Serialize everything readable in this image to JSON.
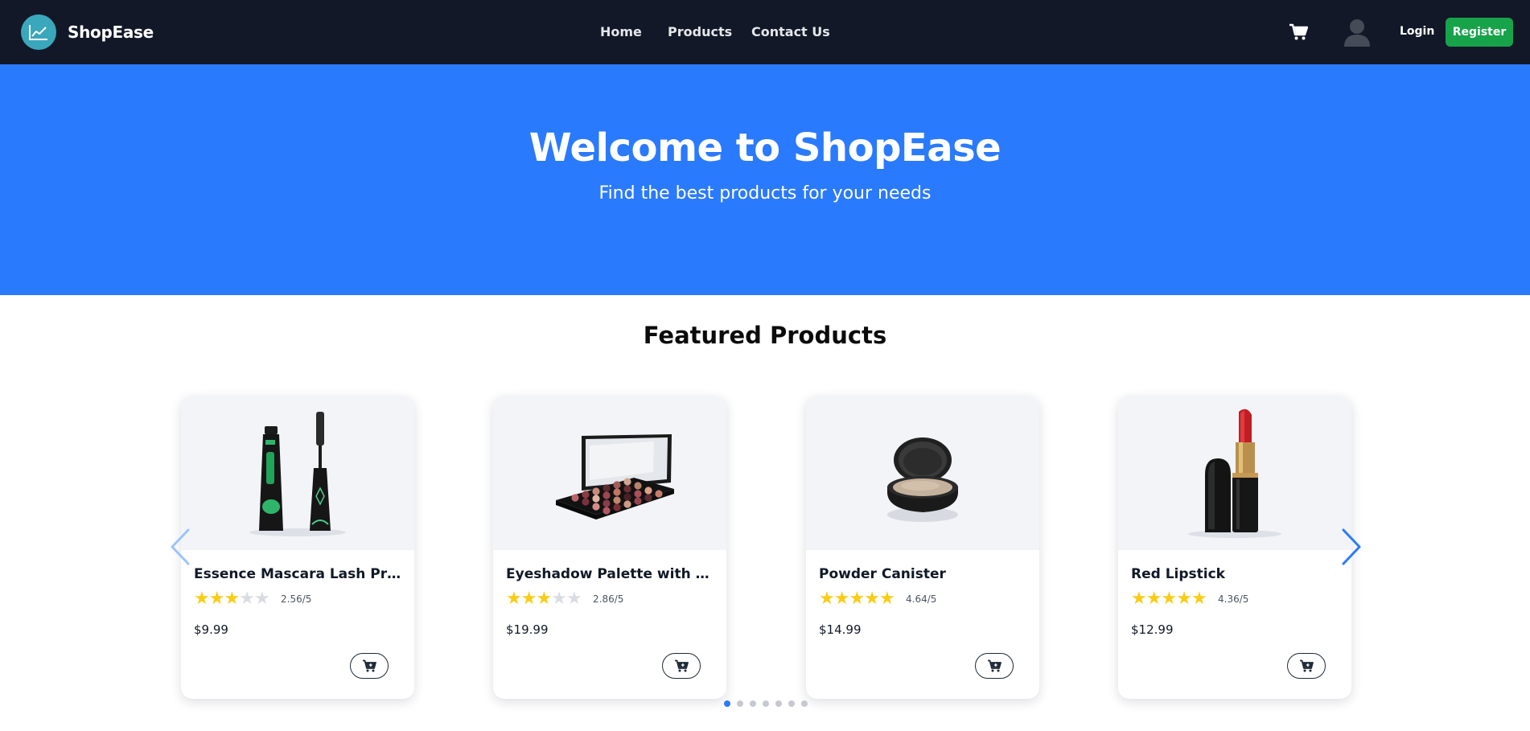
{
  "brand": {
    "name": "ShopEase",
    "logo_icon": "trend-chart-icon"
  },
  "nav": {
    "links": [
      "Home",
      "Products",
      "Contact Us"
    ],
    "cart_icon": "cart-icon",
    "avatar_icon": "user-avatar-icon",
    "login": "Login",
    "register": "Register"
  },
  "hero": {
    "title": "Welcome to ShopEase",
    "subtitle": "Find the best products for your needs"
  },
  "featured": {
    "title": "Featured Products",
    "products": [
      {
        "name": "Essence Mascara Lash Princess",
        "rating": 2.56,
        "rating_text": "2.56/5",
        "stars_filled": 3,
        "price": "$9.99",
        "image_icon": "mascara-image"
      },
      {
        "name": "Eyeshadow Palette with Mirr...",
        "rating": 2.86,
        "rating_text": "2.86/5",
        "stars_filled": 3,
        "price": "$19.99",
        "image_icon": "eyeshadow-palette-image"
      },
      {
        "name": "Powder Canister",
        "rating": 4.64,
        "rating_text": "4.64/5",
        "stars_filled": 5,
        "price": "$14.99",
        "image_icon": "powder-canister-image"
      },
      {
        "name": "Red Lipstick",
        "rating": 4.36,
        "rating_text": "4.36/5",
        "stars_filled": 5,
        "price": "$12.99",
        "image_icon": "red-lipstick-image"
      }
    ],
    "carousel": {
      "total_pages": 7,
      "active_page": 1,
      "prev_icon": "chevron-left-icon",
      "next_icon": "chevron-right-icon"
    }
  },
  "colors": {
    "navbar": "#121827",
    "hero": "#2a7afe",
    "register": "#16a34a",
    "star": "#facc15",
    "accent": "#2a7afe"
  }
}
